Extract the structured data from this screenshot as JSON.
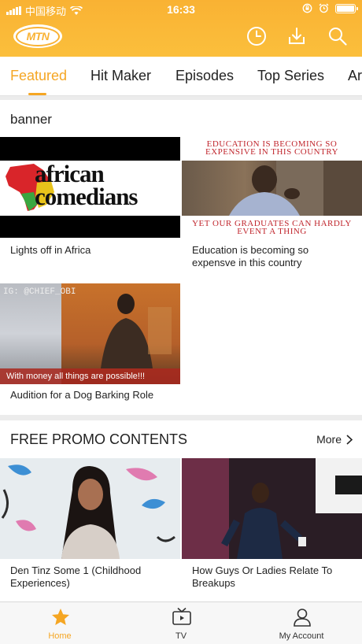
{
  "status_bar": {
    "carrier": "中国移动",
    "time": "16:33"
  },
  "header": {
    "logo_text": "MTN",
    "icons": [
      "history-icon",
      "download-icon",
      "search-icon"
    ],
    "brand_color": "#f9b233"
  },
  "tabs": [
    {
      "label": "Featured",
      "active": true
    },
    {
      "label": "Hit Maker",
      "active": false
    },
    {
      "label": "Episodes",
      "active": false
    },
    {
      "label": "Top Series",
      "active": false
    },
    {
      "label": "Ar",
      "active": false
    }
  ],
  "banner_section": {
    "title": "banner",
    "items": [
      {
        "caption": "Lights off in Africa",
        "thumb_text_1": "african",
        "thumb_text_2": "comedians"
      },
      {
        "caption": "Education is becoming so expensve in this country",
        "thumb_top": "EDUCATION IS BECOMING SO EXPENSIVE IN THIS COUNTRY",
        "thumb_bottom": "YET OUR GRADUATES CAN HARDLY EVENT A THING"
      },
      {
        "caption": "Audition for a Dog Barking Role",
        "thumb_tag": "IG: @CHIEF_OBI",
        "thumb_strip": "With money all things are possible!!!"
      }
    ]
  },
  "promo_section": {
    "title": "FREE PROMO CONTENTS",
    "more_label": "More",
    "items": [
      {
        "caption": "Den Tinz Some 1 (Childhood Experiences)"
      },
      {
        "caption": "How Guys Or Ladies Relate To Breakups"
      }
    ]
  },
  "bottom_nav": [
    {
      "label": "Home",
      "icon": "star-icon",
      "active": true
    },
    {
      "label": "TV",
      "icon": "tv-icon",
      "active": false
    },
    {
      "label": "My Account",
      "icon": "user-icon",
      "active": false
    }
  ],
  "accent_color": "#f5a623"
}
